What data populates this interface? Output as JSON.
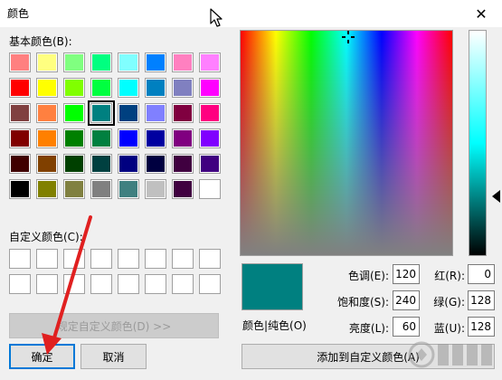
{
  "window": {
    "title": "颜色",
    "close_glyph": "✕"
  },
  "basic_colors": {
    "label": "基本颜色(B):",
    "swatches": [
      "#ff8080",
      "#ffff80",
      "#80ff80",
      "#00ff80",
      "#80ffff",
      "#0080ff",
      "#ff80c0",
      "#ff80ff",
      "#ff0000",
      "#ffff00",
      "#80ff00",
      "#00ff40",
      "#00ffff",
      "#0080c0",
      "#8080c0",
      "#ff00ff",
      "#804040",
      "#ff8040",
      "#00ff00",
      "#008080",
      "#004080",
      "#8080ff",
      "#800040",
      "#ff0080",
      "#800000",
      "#ff8000",
      "#008000",
      "#008040",
      "#0000ff",
      "#0000a0",
      "#800080",
      "#8000ff",
      "#400000",
      "#804000",
      "#004000",
      "#004040",
      "#000080",
      "#000040",
      "#400040",
      "#400080",
      "#000000",
      "#808000",
      "#808040",
      "#808080",
      "#408080",
      "#c0c0c0",
      "#400040",
      "#ffffff"
    ],
    "selected_index": 19
  },
  "custom_colors": {
    "label": "自定义颜色(C):",
    "count": 16
  },
  "buttons": {
    "define_custom": "规定自定义颜色(D) >>",
    "ok": "确定",
    "cancel": "取消",
    "add_custom": "添加到自定义颜色(A)"
  },
  "preview": {
    "label": "颜色|纯色(O)",
    "color": "#008080"
  },
  "fields": {
    "hue": {
      "label": "色调(E):",
      "value": "120"
    },
    "sat": {
      "label": "饱和度(S):",
      "value": "240"
    },
    "lum": {
      "label": "亮度(L):",
      "value": "60"
    },
    "red": {
      "label": "红(R):",
      "value": "0"
    },
    "green": {
      "label": "绿(G):",
      "value": "128"
    },
    "blue": {
      "label": "蓝(U):",
      "value": "128"
    }
  },
  "annotation": {
    "arrow_color": "#e02020"
  }
}
